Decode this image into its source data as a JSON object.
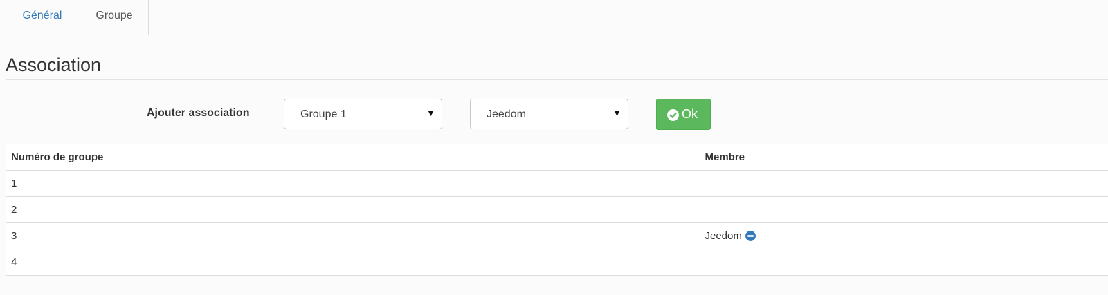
{
  "tabs": [
    {
      "label": "Général",
      "active": false
    },
    {
      "label": "Groupe",
      "active": true
    }
  ],
  "section": {
    "title": "Association"
  },
  "form": {
    "label": "Ajouter association",
    "group_select": {
      "value": "Groupe 1"
    },
    "member_select": {
      "value": "Jeedom"
    },
    "ok_button": {
      "label": "Ok",
      "icon": "check-circle-icon",
      "color": "#5cb85c"
    }
  },
  "table": {
    "headers": [
      "Numéro de groupe",
      "Membre"
    ],
    "rows": [
      {
        "group": "1",
        "member": ""
      },
      {
        "group": "2",
        "member": ""
      },
      {
        "group": "3",
        "member": "Jeedom",
        "remove_icon": "minus-circle-icon"
      },
      {
        "group": "4",
        "member": ""
      }
    ]
  },
  "colors": {
    "link": "#337ab7",
    "remove_icon": "#337ab7"
  }
}
